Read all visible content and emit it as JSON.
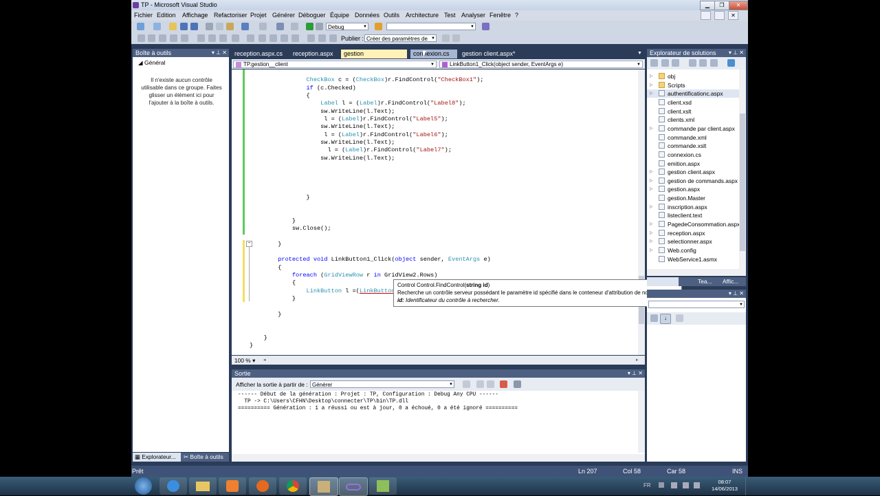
{
  "window": {
    "title": "TP - Microsoft Visual Studio"
  },
  "menu": [
    "Fichier",
    "Edition",
    "Affichage",
    "Refactoriser",
    "Projet",
    "Générer",
    "Déboguer",
    "Équipe",
    "Données",
    "Outils",
    "Architecture",
    "Test",
    "Analyser",
    "Fenêtre",
    "?"
  ],
  "toolbar": {
    "config": "Debug",
    "publish_label": "Publier :",
    "publish_value": "Créer des paramètres de"
  },
  "toolbox": {
    "title": "Boîte à outils",
    "group": "Général",
    "empty_message": "Il n'existe aucun contrôle utilisable dans ce groupe. Faites glisser un élément ici pour l'ajouter à la boîte à outils."
  },
  "tabs": [
    "reception.aspx.cs",
    "reception.aspx",
    "gestion  client.aspx.cs*",
    "connexion.cs",
    "gestion  client.aspx*"
  ],
  "nav": {
    "class": "TP.gestion__client",
    "member": "LinkButton1_Click(object sender, EventArgs e)"
  },
  "code_lines": [
    "                CheckBox c = (CheckBox)r.FindControl(\"CheckBox1\");",
    "                if (c.Checked)",
    "                {",
    "                    Label l = (Label)r.FindControl(\"Label8\");",
    "                    sw.WriteLine(l.Text);",
    "                     l = (Label)r.FindControl(\"Label5\");",
    "                    sw.WriteLine(l.Text);",
    "                     l = (Label)r.FindControl(\"Label6\");",
    "                    sw.WriteLine(l.Text);",
    "                      l = (Label)r.FindControl(\"Label7\");",
    "                    sw.WriteLine(l.Text);",
    "",
    "",
    "",
    "",
    "                }",
    "",
    "",
    "            }",
    "            sw.Close();",
    "",
    "        }",
    "",
    "        protected void LinkButton1_Click(object sender, EventArgs e)",
    "        {",
    "            foreach (GridViewRow r in GridView2.Rows)",
    "            {",
    "                LinkButton l =(LinkButton)r.FindControl(\"",
    "            }",
    "",
    "        }",
    "",
    "",
    "    }",
    "}"
  ],
  "tooltip": {
    "signature_prefix": "Control Control.FindControl(",
    "signature_param": "string id",
    "signature_suffix": ")",
    "description": "Recherche un contrôle serveur possédant le paramètre id spécifié dans le conteneur d'attribution de noms actuel.",
    "param_name": "id:",
    "param_desc": "Identificateur du contrôle à rechercher."
  },
  "zoom": "100 %",
  "output": {
    "title": "Sortie",
    "show_from_label": "Afficher la sortie à partir de :",
    "show_from_value": "Générer",
    "lines": [
      "------ Début de la génération : Projet : TP, Configuration : Debug Any CPU ------",
      "  TP -> C:\\Users\\CFHN\\Desktop\\connecter\\TP\\bin\\TP.dll",
      "========== Génération : 1 a réussi ou est à jour, 0 a échoué, 0 a été ignoré =========="
    ]
  },
  "solution_explorer": {
    "title": "Explorateur de solutions",
    "items": [
      "obj",
      "Scripts",
      "authentificationc.aspx",
      "client.xsd",
      "client.xslt",
      "clients.xml",
      "commande par client.aspx",
      "commande.xml",
      "commande.xslt",
      "connexion.cs",
      "emition.aspx",
      "gestion  client.aspx",
      "gestion de commands.aspx",
      "gestion.aspx",
      "gestion.Master",
      "inscription.aspx",
      "listeclient.text",
      "PagedeConsommation.aspx",
      "reception.aspx",
      "selectionner.aspx",
      "Web.config",
      "WebService1.asmx"
    ],
    "tabs": [
      "Tea...",
      "Affic..."
    ]
  },
  "bottom_tabs": [
    "Explorateur...",
    "Boîte à outils"
  ],
  "status": {
    "state": "Prêt",
    "line": "Ln 207",
    "col": "Col 58",
    "char": "Car 58",
    "mode": "INS"
  },
  "taskbar": {
    "lang": "FR",
    "time": "08:07",
    "date": "14/06/2013"
  }
}
